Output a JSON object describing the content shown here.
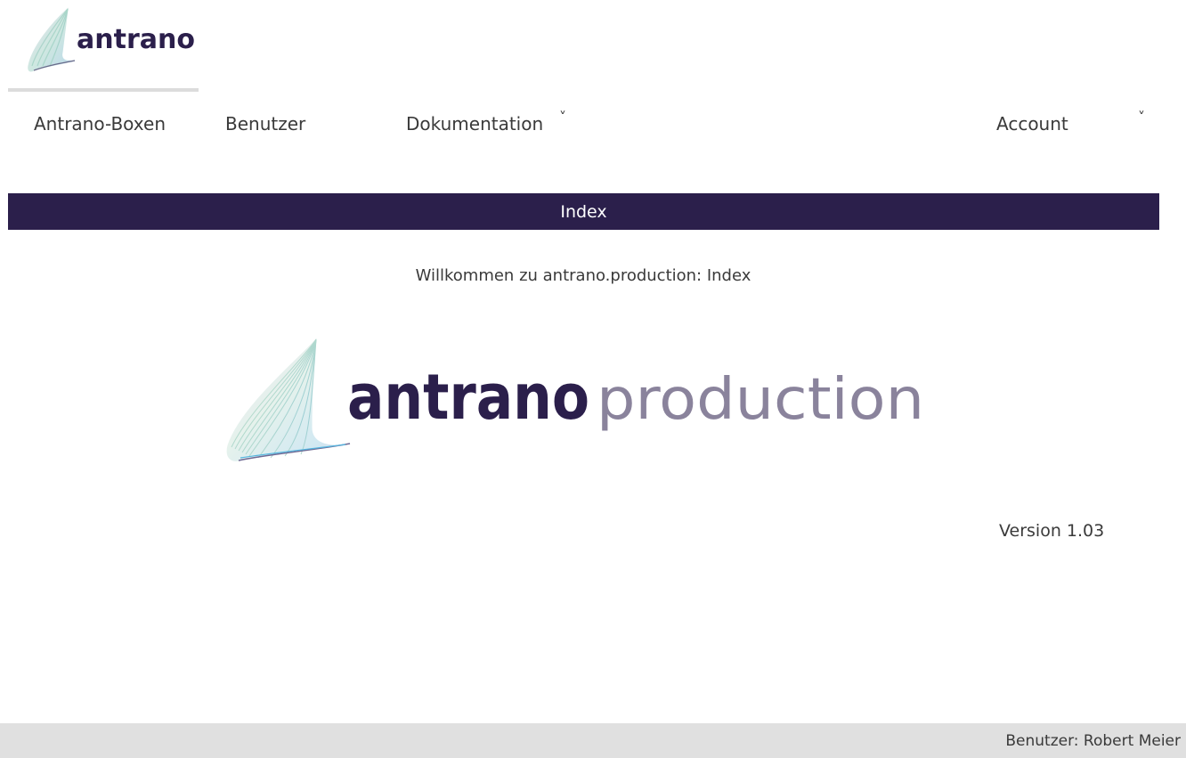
{
  "header": {
    "logo_text": "antrano"
  },
  "nav": {
    "items": [
      {
        "label": "Antrano-Boxen"
      },
      {
        "label": "Benutzer"
      },
      {
        "label": "Dokumentation"
      }
    ],
    "account_label": "Account",
    "chevron": "˅"
  },
  "main": {
    "bar_title": "Index",
    "welcome": "Willkommen zu antrano.production: Index",
    "logo_word_bold": "antrano",
    "logo_word_light": "production",
    "version": "Version 1.03"
  },
  "footer": {
    "user": "Benutzer: Robert Meier"
  },
  "colors": {
    "brand_dark": "#2b1f4b",
    "logo_light": "#8a839c",
    "footer_bg": "#e0e0e0"
  }
}
